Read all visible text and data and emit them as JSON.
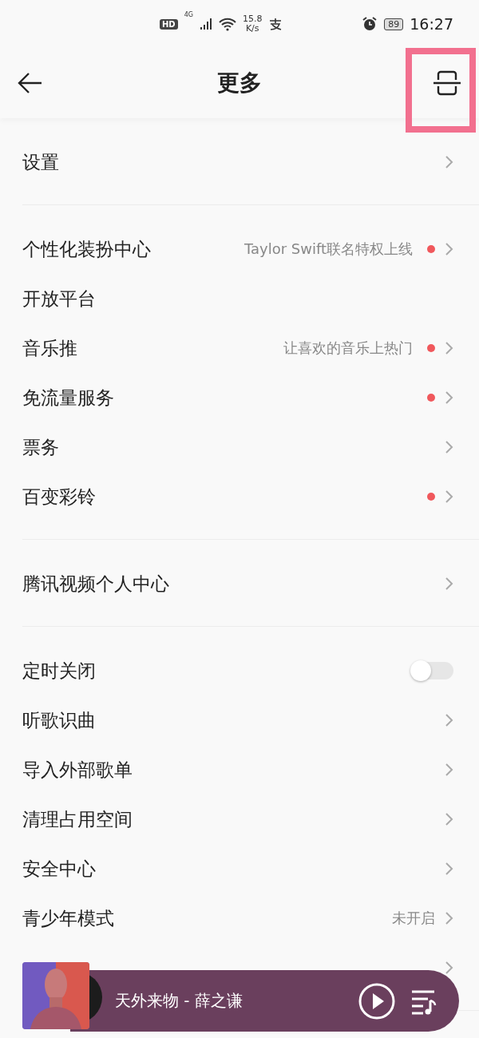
{
  "status_bar": {
    "hd": "HD",
    "network": "4G",
    "speed_value": "15.8",
    "speed_unit": "K/s",
    "battery": "89",
    "time": "16:27"
  },
  "header": {
    "title": "更多"
  },
  "sections": [
    {
      "items": [
        {
          "kind": "link",
          "label": "设置",
          "badge": false
        }
      ]
    },
    {
      "items": [
        {
          "kind": "link",
          "label": "个性化装扮中心",
          "detail": "Taylor Swift联名特权上线",
          "badge": true
        },
        {
          "kind": "plain",
          "label": "开放平台",
          "badge": false
        },
        {
          "kind": "link",
          "label": "音乐推",
          "detail": "让喜欢的音乐上热门",
          "badge": true
        },
        {
          "kind": "link",
          "label": "免流量服务",
          "badge": true
        },
        {
          "kind": "link",
          "label": "票务",
          "badge": false
        },
        {
          "kind": "link",
          "label": "百变彩铃",
          "badge": true
        }
      ]
    },
    {
      "items": [
        {
          "kind": "link",
          "label": "腾讯视频个人中心",
          "badge": false
        }
      ]
    },
    {
      "items": [
        {
          "kind": "toggle",
          "label": "定时关闭",
          "on": false,
          "badge": false
        },
        {
          "kind": "link",
          "label": "听歌识曲",
          "badge": false
        },
        {
          "kind": "link",
          "label": "导入外部歌单",
          "badge": false
        },
        {
          "kind": "link",
          "label": "清理占用空间",
          "badge": false
        },
        {
          "kind": "link",
          "label": "安全中心",
          "badge": false
        },
        {
          "kind": "link",
          "label": "青少年模式",
          "detail": "未开启",
          "badge": false
        },
        {
          "kind": "link",
          "badge": false
        }
      ]
    }
  ],
  "player": {
    "song": "天外来物 - 薛之谦",
    "playing": false
  }
}
